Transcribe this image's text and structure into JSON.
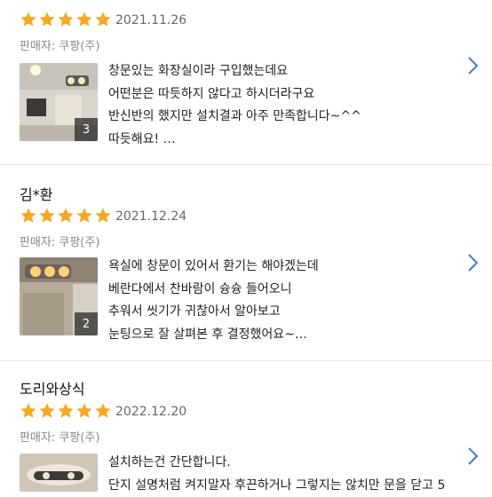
{
  "colors": {
    "star": "#f6a825",
    "chevron": "#4a78c4",
    "divider": "#e6e6e6"
  },
  "reviews": [
    {
      "reviewer": "",
      "rating": 5,
      "date": "2021.11.26",
      "seller": "판매자: 쿠팡(주)",
      "photo_count": "3",
      "lines": [
        "창문있는 화장실이라 구입했는데요",
        "어떤분은 따듯하지 않다고 하시더라구요",
        "반신반의 했지만 설치결과 아주 만족합니다~^^",
        "따듯해요! …"
      ]
    },
    {
      "reviewer": "김*환",
      "rating": 5,
      "date": "2021.12.24",
      "seller": "판매자: 쿠팡(주)",
      "photo_count": "2",
      "lines": [
        "욕실에 창문이 있어서 환기는 해야겠는데",
        "베란다에서 찬바람이 슝슝 들어오니",
        "추워서 씻기가 귀찮아서 알아보고",
        "눈팅으로 잘 살펴본 후 결정했어요~…"
      ]
    },
    {
      "reviewer": "도리와상식",
      "rating": 5,
      "date": "2022.12.20",
      "seller": "판매자: 쿠팡(주)",
      "photo_count": "",
      "lines": [
        "설치하는건 간단합니다.",
        "단지 설명처럼 켜지말자 후끈하거나 그렇지는 않치만 문을 닫고 5"
      ]
    }
  ]
}
